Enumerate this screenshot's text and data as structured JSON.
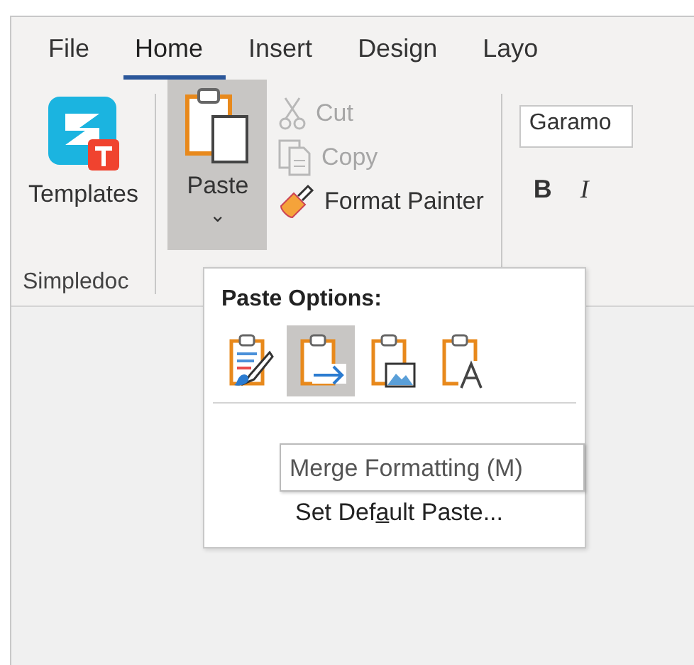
{
  "tabs": [
    {
      "label": "File",
      "selected": false
    },
    {
      "label": "Home",
      "selected": true
    },
    {
      "label": "Insert",
      "selected": false
    },
    {
      "label": "Design",
      "selected": false
    },
    {
      "label": "Layo",
      "selected": false
    }
  ],
  "groups": [
    {
      "label": "Simpledoc",
      "templates_button": {
        "label": "Templates"
      }
    },
    {
      "paste_button": {
        "label": "Paste",
        "caret": "⌄",
        "expanded": true
      },
      "small_buttons": [
        {
          "kind": "cut",
          "label": "Cut",
          "disabled": true
        },
        {
          "kind": "copy",
          "label": "Copy",
          "disabled": true
        },
        {
          "kind": "painter",
          "label": "Format Painter",
          "disabled": false
        }
      ]
    },
    {
      "font_field": {
        "value": "Garamo"
      },
      "format_buttons": [
        {
          "kind": "bold",
          "label": "B"
        },
        {
          "kind": "italic",
          "label": "I"
        }
      ]
    }
  ],
  "paste_menu": {
    "title": "Paste Options:",
    "options": [
      {
        "kind": "keep-source",
        "selected": false
      },
      {
        "kind": "merge",
        "selected": true
      },
      {
        "kind": "picture",
        "selected": false
      },
      {
        "kind": "text-only",
        "selected": false
      }
    ],
    "items": [
      {
        "before": "Set Def",
        "access_key": "a",
        "after": "ult Paste..."
      }
    ]
  },
  "tooltip": {
    "text": "Merge Formatting (M)"
  }
}
